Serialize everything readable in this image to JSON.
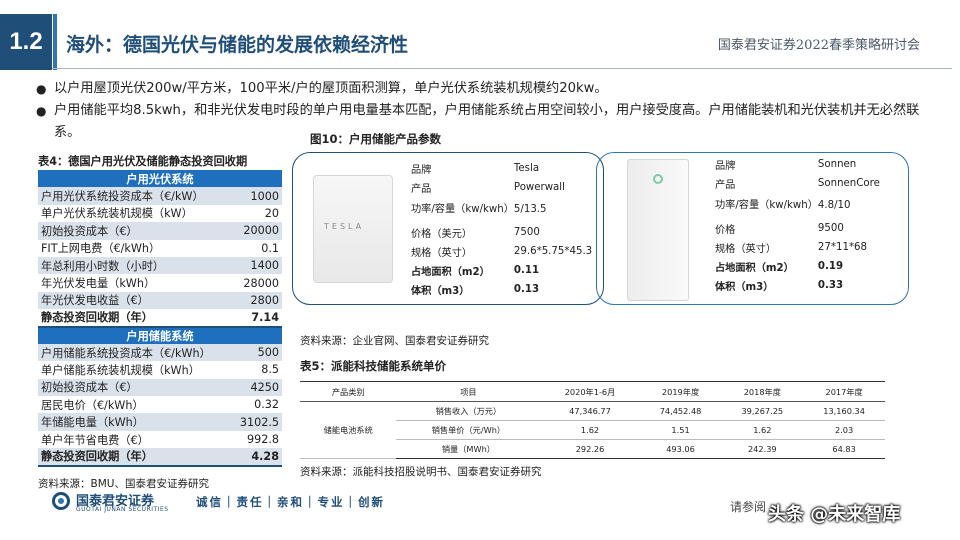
{
  "header": {
    "section": "1.2",
    "title": "海外：德国光伏与储能的发展依赖经济性",
    "event": "国泰君安证券2022春季策略研讨会"
  },
  "bullets": [
    "以户用屋顶光伏200w/平方米，100平米/户的屋顶面积测算，单户光伏系统装机规模约20kw。",
    "户用储能平均8.5kwh，和非光伏发电时段的单户用电量基本匹配，户用储能系统占用空间较小，用户接受度高。户用储能装机和光伏装机并无必然联系。"
  ],
  "table4": {
    "title": "表4：德国户用光伏及储能静态投资回收期",
    "pv_header": "户用光伏系统",
    "pv_rows": [
      {
        "label": "户用光伏系统投资成本（€/kW）",
        "value": "1000"
      },
      {
        "label": "单户光伏系统装机规模（kW）",
        "value": "20"
      },
      {
        "label": "初始投资成本（€）",
        "value": "20000"
      },
      {
        "label": "FIT上网电费（€/kWh）",
        "value": "0.1"
      },
      {
        "label": "年总利用小时数（小时）",
        "value": "1400"
      },
      {
        "label": "年光伏发电量（kWh）",
        "value": "28000"
      },
      {
        "label": "年光伏发电收益（€）",
        "value": "2800"
      },
      {
        "label": "静态投资回收期（年）",
        "value": "7.14"
      }
    ],
    "es_header": "户用储能系统",
    "es_rows": [
      {
        "label": "户用储能系统投资成本（€/kWh）",
        "value": "500"
      },
      {
        "label": "单户储能系统装机规模（kWh）",
        "value": "8.5"
      },
      {
        "label": "初始投资成本（€）",
        "value": "4250"
      },
      {
        "label": "居民电价（€/kWh）",
        "value": "0.32"
      },
      {
        "label": "年储能电量（kWh）",
        "value": "3102.5"
      },
      {
        "label": "单户年节省电费（€）",
        "value": "992.8"
      },
      {
        "label": "静态投资回收期（年）",
        "value": "4.28"
      }
    ],
    "source": "资料来源：BMU、国泰君安证券研究"
  },
  "figure10": {
    "title": "图10：户用储能产品参数",
    "tesla_logo": "TESLA",
    "tesla": [
      {
        "k": "品牌",
        "v": "Tesla"
      },
      {
        "k": "产品",
        "v": "Powerwall"
      },
      {
        "k": "功率/容量（kw/kwh）",
        "v": "5/13.5"
      },
      {
        "k": "价格（美元）",
        "v": "7500"
      },
      {
        "k": "规格（英寸）",
        "v": "29.6*5.75*45.3"
      },
      {
        "k": "占地面积（m2）",
        "v": "0.11"
      },
      {
        "k": "体积（m3）",
        "v": "0.13"
      }
    ],
    "sonnen": [
      {
        "k": "品牌",
        "v": "Sonnen"
      },
      {
        "k": "产品",
        "v": "SonnenCore"
      },
      {
        "k": "功率/容量（kw/kwh）",
        "v": "4.8/10"
      },
      {
        "k": "价格",
        "v": "9500"
      },
      {
        "k": "规格（英寸）",
        "v": "27*11*68"
      },
      {
        "k": "占地面积（m2）",
        "v": "0.19"
      },
      {
        "k": "体积（m3）",
        "v": "0.33"
      }
    ],
    "source": "资料来源：企业官网、国泰君安证券研究"
  },
  "table5": {
    "title": "表5：派能科技储能系统单价",
    "headers": [
      "产品类别",
      "项目",
      "2020年1-6月",
      "2019年度",
      "2018年度",
      "2017年度"
    ],
    "category": "储能电池系统",
    "rows": [
      [
        "销售收入（万元）",
        "47,346.77",
        "74,452.48",
        "39,267.25",
        "13,160.34"
      ],
      [
        "销售单价（元/Wh）",
        "1.62",
        "1.51",
        "1.62",
        "2.03"
      ],
      [
        "销量（MWh）",
        "292.26",
        "493.06",
        "242.39",
        "64.83"
      ]
    ],
    "source": "资料来源：派能科技招股说明书、国泰君安证券研究"
  },
  "footer": {
    "brand": "国泰君安证券",
    "brand_en": "GUOTAI JUNAN SECURITIES",
    "slogan": "诚信｜责任｜亲和｜专业｜创新",
    "disclaimer": "请参阅",
    "watermark": "头条 @未来智库"
  }
}
